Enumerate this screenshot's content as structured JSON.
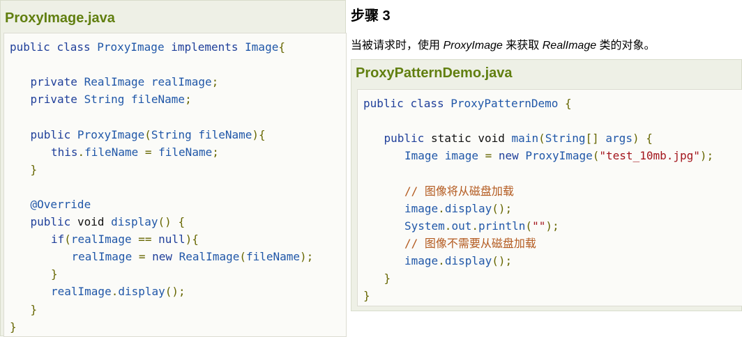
{
  "left_file": {
    "title": "ProxyImage.java",
    "lines": [
      {
        "indent": 0,
        "tokens": [
          [
            "kw",
            "public"
          ],
          [
            "pl",
            " "
          ],
          [
            "kw",
            "class"
          ],
          [
            "pl",
            " ProxyImage "
          ],
          [
            "kw",
            "implements"
          ],
          [
            "pl",
            " Image"
          ],
          [
            "pn",
            "{"
          ]
        ]
      },
      {
        "indent": 0,
        "tokens": []
      },
      {
        "indent": 1,
        "tokens": [
          [
            "kw",
            "private"
          ],
          [
            "pl",
            " RealImage realImage"
          ],
          [
            "pn",
            ";"
          ]
        ]
      },
      {
        "indent": 1,
        "tokens": [
          [
            "kw",
            "private"
          ],
          [
            "pl",
            " String fileName"
          ],
          [
            "pn",
            ";"
          ]
        ]
      },
      {
        "indent": 0,
        "tokens": []
      },
      {
        "indent": 1,
        "tokens": [
          [
            "kw",
            "public"
          ],
          [
            "pl",
            " ProxyImage"
          ],
          [
            "pn",
            "("
          ],
          [
            "pl",
            "String fileName"
          ],
          [
            "pn",
            "){"
          ]
        ]
      },
      {
        "indent": 2,
        "tokens": [
          [
            "kw",
            "this"
          ],
          [
            "pn",
            "."
          ],
          [
            "pl",
            "fileName "
          ],
          [
            "pn",
            "="
          ],
          [
            "pl",
            " fileName"
          ],
          [
            "pn",
            ";"
          ]
        ]
      },
      {
        "indent": 1,
        "tokens": [
          [
            "pn",
            "}"
          ]
        ]
      },
      {
        "indent": 0,
        "tokens": []
      },
      {
        "indent": 1,
        "tokens": [
          [
            "an",
            "@Override"
          ]
        ]
      },
      {
        "indent": 1,
        "tokens": [
          [
            "kw",
            "public"
          ],
          [
            "pl",
            " "
          ],
          [
            "kd",
            "void"
          ],
          [
            "pl",
            " display"
          ],
          [
            "pn",
            "()"
          ],
          [
            "pl",
            " "
          ],
          [
            "pn",
            "{"
          ]
        ]
      },
      {
        "indent": 2,
        "tokens": [
          [
            "kw",
            "if"
          ],
          [
            "pn",
            "("
          ],
          [
            "pl",
            "realImage "
          ],
          [
            "pn",
            "=="
          ],
          [
            "pl",
            " "
          ],
          [
            "kw",
            "null"
          ],
          [
            "pn",
            "){"
          ]
        ]
      },
      {
        "indent": 3,
        "tokens": [
          [
            "pl",
            "realImage "
          ],
          [
            "pn",
            "="
          ],
          [
            "pl",
            " "
          ],
          [
            "kw",
            "new"
          ],
          [
            "pl",
            " RealImage"
          ],
          [
            "pn",
            "("
          ],
          [
            "pl",
            "fileName"
          ],
          [
            "pn",
            ");"
          ]
        ]
      },
      {
        "indent": 2,
        "tokens": [
          [
            "pn",
            "}"
          ]
        ]
      },
      {
        "indent": 2,
        "tokens": [
          [
            "pl",
            "realImage"
          ],
          [
            "pn",
            "."
          ],
          [
            "pl",
            "display"
          ],
          [
            "pn",
            "();"
          ]
        ]
      },
      {
        "indent": 1,
        "tokens": [
          [
            "pn",
            "}"
          ]
        ]
      },
      {
        "indent": 0,
        "tokens": [
          [
            "pn",
            "}"
          ]
        ]
      }
    ]
  },
  "step": {
    "title": "步骤 3",
    "desc_parts": [
      {
        "text": "当被请求时，使用 ",
        "italic": false
      },
      {
        "text": "ProxyImage",
        "italic": true
      },
      {
        "text": " 来获取 ",
        "italic": false
      },
      {
        "text": "RealImage",
        "italic": true
      },
      {
        "text": " 类的对象。",
        "italic": false
      }
    ]
  },
  "right_file": {
    "title": "ProxyPatternDemo.java",
    "lines": [
      {
        "indent": 0,
        "tokens": [
          [
            "kw",
            "public"
          ],
          [
            "pl",
            " "
          ],
          [
            "kw",
            "class"
          ],
          [
            "pl",
            " ProxyPatternDemo "
          ],
          [
            "pn",
            "{"
          ]
        ]
      },
      {
        "indent": 0,
        "tokens": []
      },
      {
        "indent": 1,
        "tokens": [
          [
            "kw",
            "public"
          ],
          [
            "pl",
            " "
          ],
          [
            "kd",
            "static"
          ],
          [
            "pl",
            " "
          ],
          [
            "kd",
            "void"
          ],
          [
            "pl",
            " main"
          ],
          [
            "pn",
            "("
          ],
          [
            "pl",
            "String"
          ],
          [
            "pn",
            "[]"
          ],
          [
            "pl",
            " args"
          ],
          [
            "pn",
            ")"
          ],
          [
            "pl",
            " "
          ],
          [
            "pn",
            "{"
          ]
        ]
      },
      {
        "indent": 2,
        "tokens": [
          [
            "pl",
            "Image image "
          ],
          [
            "pn",
            "="
          ],
          [
            "pl",
            " "
          ],
          [
            "kw",
            "new"
          ],
          [
            "pl",
            " ProxyImage"
          ],
          [
            "pn",
            "("
          ],
          [
            "st",
            "\"test_10mb.jpg\""
          ],
          [
            "pn",
            ");"
          ]
        ]
      },
      {
        "indent": 0,
        "tokens": []
      },
      {
        "indent": 2,
        "tokens": [
          [
            "cm",
            "// 图像将从磁盘加载"
          ]
        ]
      },
      {
        "indent": 2,
        "tokens": [
          [
            "pl",
            "image"
          ],
          [
            "pn",
            "."
          ],
          [
            "pl",
            "display"
          ],
          [
            "pn",
            "();"
          ]
        ]
      },
      {
        "indent": 2,
        "tokens": [
          [
            "pl",
            "System"
          ],
          [
            "pn",
            "."
          ],
          [
            "pl",
            "out"
          ],
          [
            "pn",
            "."
          ],
          [
            "pl",
            "println"
          ],
          [
            "pn",
            "("
          ],
          [
            "st",
            "\"\""
          ],
          [
            "pn",
            ");"
          ]
        ]
      },
      {
        "indent": 2,
        "tokens": [
          [
            "cm",
            "// 图像不需要从磁盘加载"
          ]
        ]
      },
      {
        "indent": 2,
        "tokens": [
          [
            "pl",
            "image"
          ],
          [
            "pn",
            "."
          ],
          [
            "pl",
            "display"
          ],
          [
            "pn",
            "();"
          ]
        ]
      },
      {
        "indent": 1,
        "tokens": [
          [
            "pn",
            "}"
          ]
        ]
      },
      {
        "indent": 0,
        "tokens": [
          [
            "pn",
            "}"
          ]
        ]
      }
    ]
  }
}
